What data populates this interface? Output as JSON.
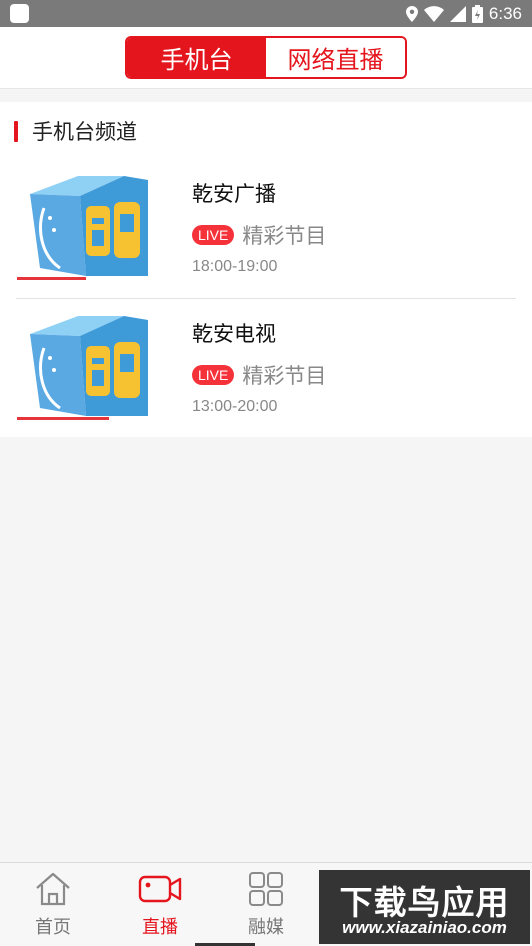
{
  "status_bar": {
    "time": "6:36"
  },
  "header": {
    "tabs": [
      {
        "label": "手机台",
        "active": true
      },
      {
        "label": "网络直播",
        "active": false
      }
    ]
  },
  "section": {
    "title": "手机台频道"
  },
  "channels": [
    {
      "name": "乾安广播",
      "live_label": "LIVE",
      "program": "精彩节目",
      "time": "18:00-19:00",
      "progress_fraction": 0.42
    },
    {
      "name": "乾安电视",
      "live_label": "LIVE",
      "program": "精彩节目",
      "time": "13:00-20:00",
      "progress_fraction": 0.56
    }
  ],
  "bottom_nav": [
    {
      "label": "首页",
      "icon": "home-icon",
      "active": false
    },
    {
      "label": "直播",
      "icon": "video-camera-icon",
      "active": true
    },
    {
      "label": "融媒",
      "icon": "grid-icon",
      "active": false
    }
  ],
  "watermark": {
    "title": "下载鸟应用",
    "url": "www.xiazainiao.com"
  },
  "colors": {
    "accent": "#e5151e",
    "live_badge": "#f5323a",
    "thumb_blue": "#3f9ad8",
    "thumb_yellow": "#f6c231"
  }
}
